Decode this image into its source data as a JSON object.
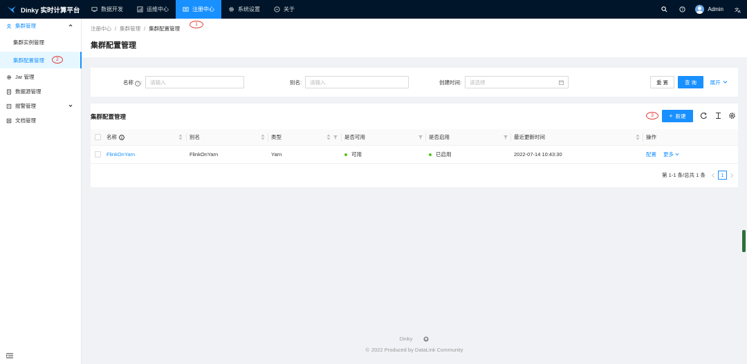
{
  "app": {
    "title": "Dinky 实时计算平台"
  },
  "nav": {
    "items": [
      {
        "label": "数据开发",
        "icon": "monitor-icon"
      },
      {
        "label": "运维中心",
        "icon": "dashboard-icon"
      },
      {
        "label": "注册中心",
        "icon": "registry-icon"
      },
      {
        "label": "系统设置",
        "icon": "gear-icon"
      },
      {
        "label": "关于",
        "icon": "info-icon"
      }
    ],
    "active_index": 2
  },
  "user": {
    "name": "Admin"
  },
  "colors": {
    "header_bg": "#001529",
    "accent": "#1890ff",
    "status_green": "#52c41a",
    "annotation": "#e04040"
  },
  "sidebar": {
    "items": [
      {
        "label": "集群管理",
        "icon": "cluster-icon",
        "open": true
      },
      {
        "label": "集群实例管理"
      },
      {
        "label": "集群配置管理",
        "selected": true
      },
      {
        "label": "Jar 管理",
        "icon": "gear-icon"
      },
      {
        "label": "数据源管理",
        "icon": "database-icon"
      },
      {
        "label": "报警管理",
        "icon": "alarm-icon"
      },
      {
        "label": "文档管理",
        "icon": "document-icon"
      }
    ]
  },
  "annotations": [
    "1",
    "2",
    "3"
  ],
  "breadcrumb": [
    "注册中心",
    "集群管理",
    "集群配置管理"
  ],
  "page": {
    "title": "集群配置管理"
  },
  "search": {
    "name_label": "名称",
    "name_placeholder": "请输入",
    "alias_label": "别名:",
    "alias_placeholder": "请输入",
    "created_label": "创建时间:",
    "created_placeholder": "请选择",
    "reset_label": "重 置",
    "query_label": "查 询",
    "expand_label": "展开"
  },
  "table": {
    "title": "集群配置管理",
    "new_label": "新建",
    "columns": [
      "名称",
      "别名",
      "类型",
      "是否可用",
      "是否启用",
      "最近更新时间",
      "操作"
    ],
    "rows": [
      {
        "name": "FlinkOnYarn",
        "alias": "FlinkOnYarn",
        "type": "Yarn",
        "available": "可用",
        "enabled": "已启用",
        "updated": "2022-07-14 10:43:30",
        "action_config": "配置",
        "action_more": "更多"
      }
    ]
  },
  "pagination": {
    "summary": "第 1-1 条/总共 1 条",
    "current": "1"
  },
  "footer": {
    "brand": "Dinky",
    "copyright": "2022 Produced by DataLink Community"
  }
}
